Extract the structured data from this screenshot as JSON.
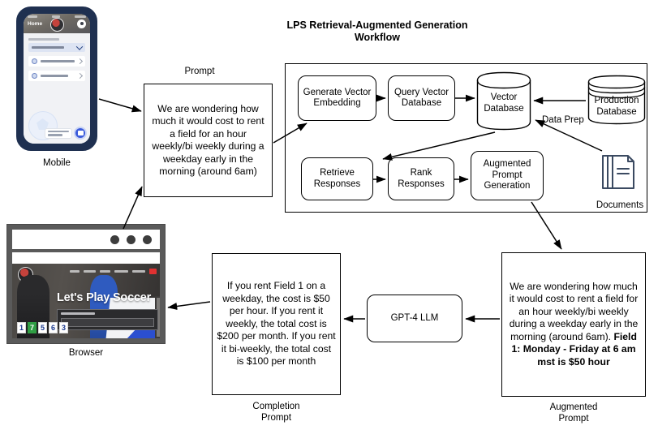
{
  "title": "LPS Retrieval-Augmented Generation Workflow",
  "devices": {
    "mobile": {
      "caption": "Mobile",
      "header_title": "Home"
    },
    "browser": {
      "caption": "Browser",
      "headline": "Let's Play Soccer",
      "numbers": [
        "1",
        "7",
        "5",
        "6",
        "3"
      ]
    }
  },
  "labels": {
    "prompt": "Prompt",
    "data_prep": "Data Prep",
    "documents": "Documents",
    "completion_prompt": "Completion\nPrompt",
    "completion_prompt_line1": "Completion",
    "completion_prompt_line2": "Prompt",
    "augmented_prompt_line1": "Augmented",
    "augmented_prompt_line2": "Prompt"
  },
  "nodes": {
    "generate_vector_embedding": "Generate Vector Embedding",
    "query_vector_database": "Query Vector Database",
    "vector_database": "Vector Database",
    "production_database": "Production Database",
    "retrieve_responses": "Retrieve Responses",
    "rank_responses": "Rank Responses",
    "augmented_prompt_generation": "Augmented Prompt Generation",
    "gpt4_llm": "GPT-4 LLM"
  },
  "texts": {
    "prompt_body": "We are wondering how much it would cost to rent a field for an hour weekly/bi weekly during a weekday early in the morning (around 6am)",
    "augmented_prompt_body": "We are wondering how much it would cost to rent a field for an hour weekly/bi weekly during a weekday early in the morning (around 6am).",
    "augmented_prompt_context": "Field 1: Monday - Friday at 6 am mst is $50 hour",
    "completion_prompt_body": "If you rent Field 1 on a weekday, the cost is $50 per hour. If you rent it weekly, the total cost is $200 per month. If you rent it bi-weekly, the total cost is $100 per month"
  },
  "colors": {
    "stroke": "#000000",
    "document_icon": "#3b4a61",
    "phone_frame": "#1f3050",
    "accent_blue": "#3b5bdb"
  }
}
